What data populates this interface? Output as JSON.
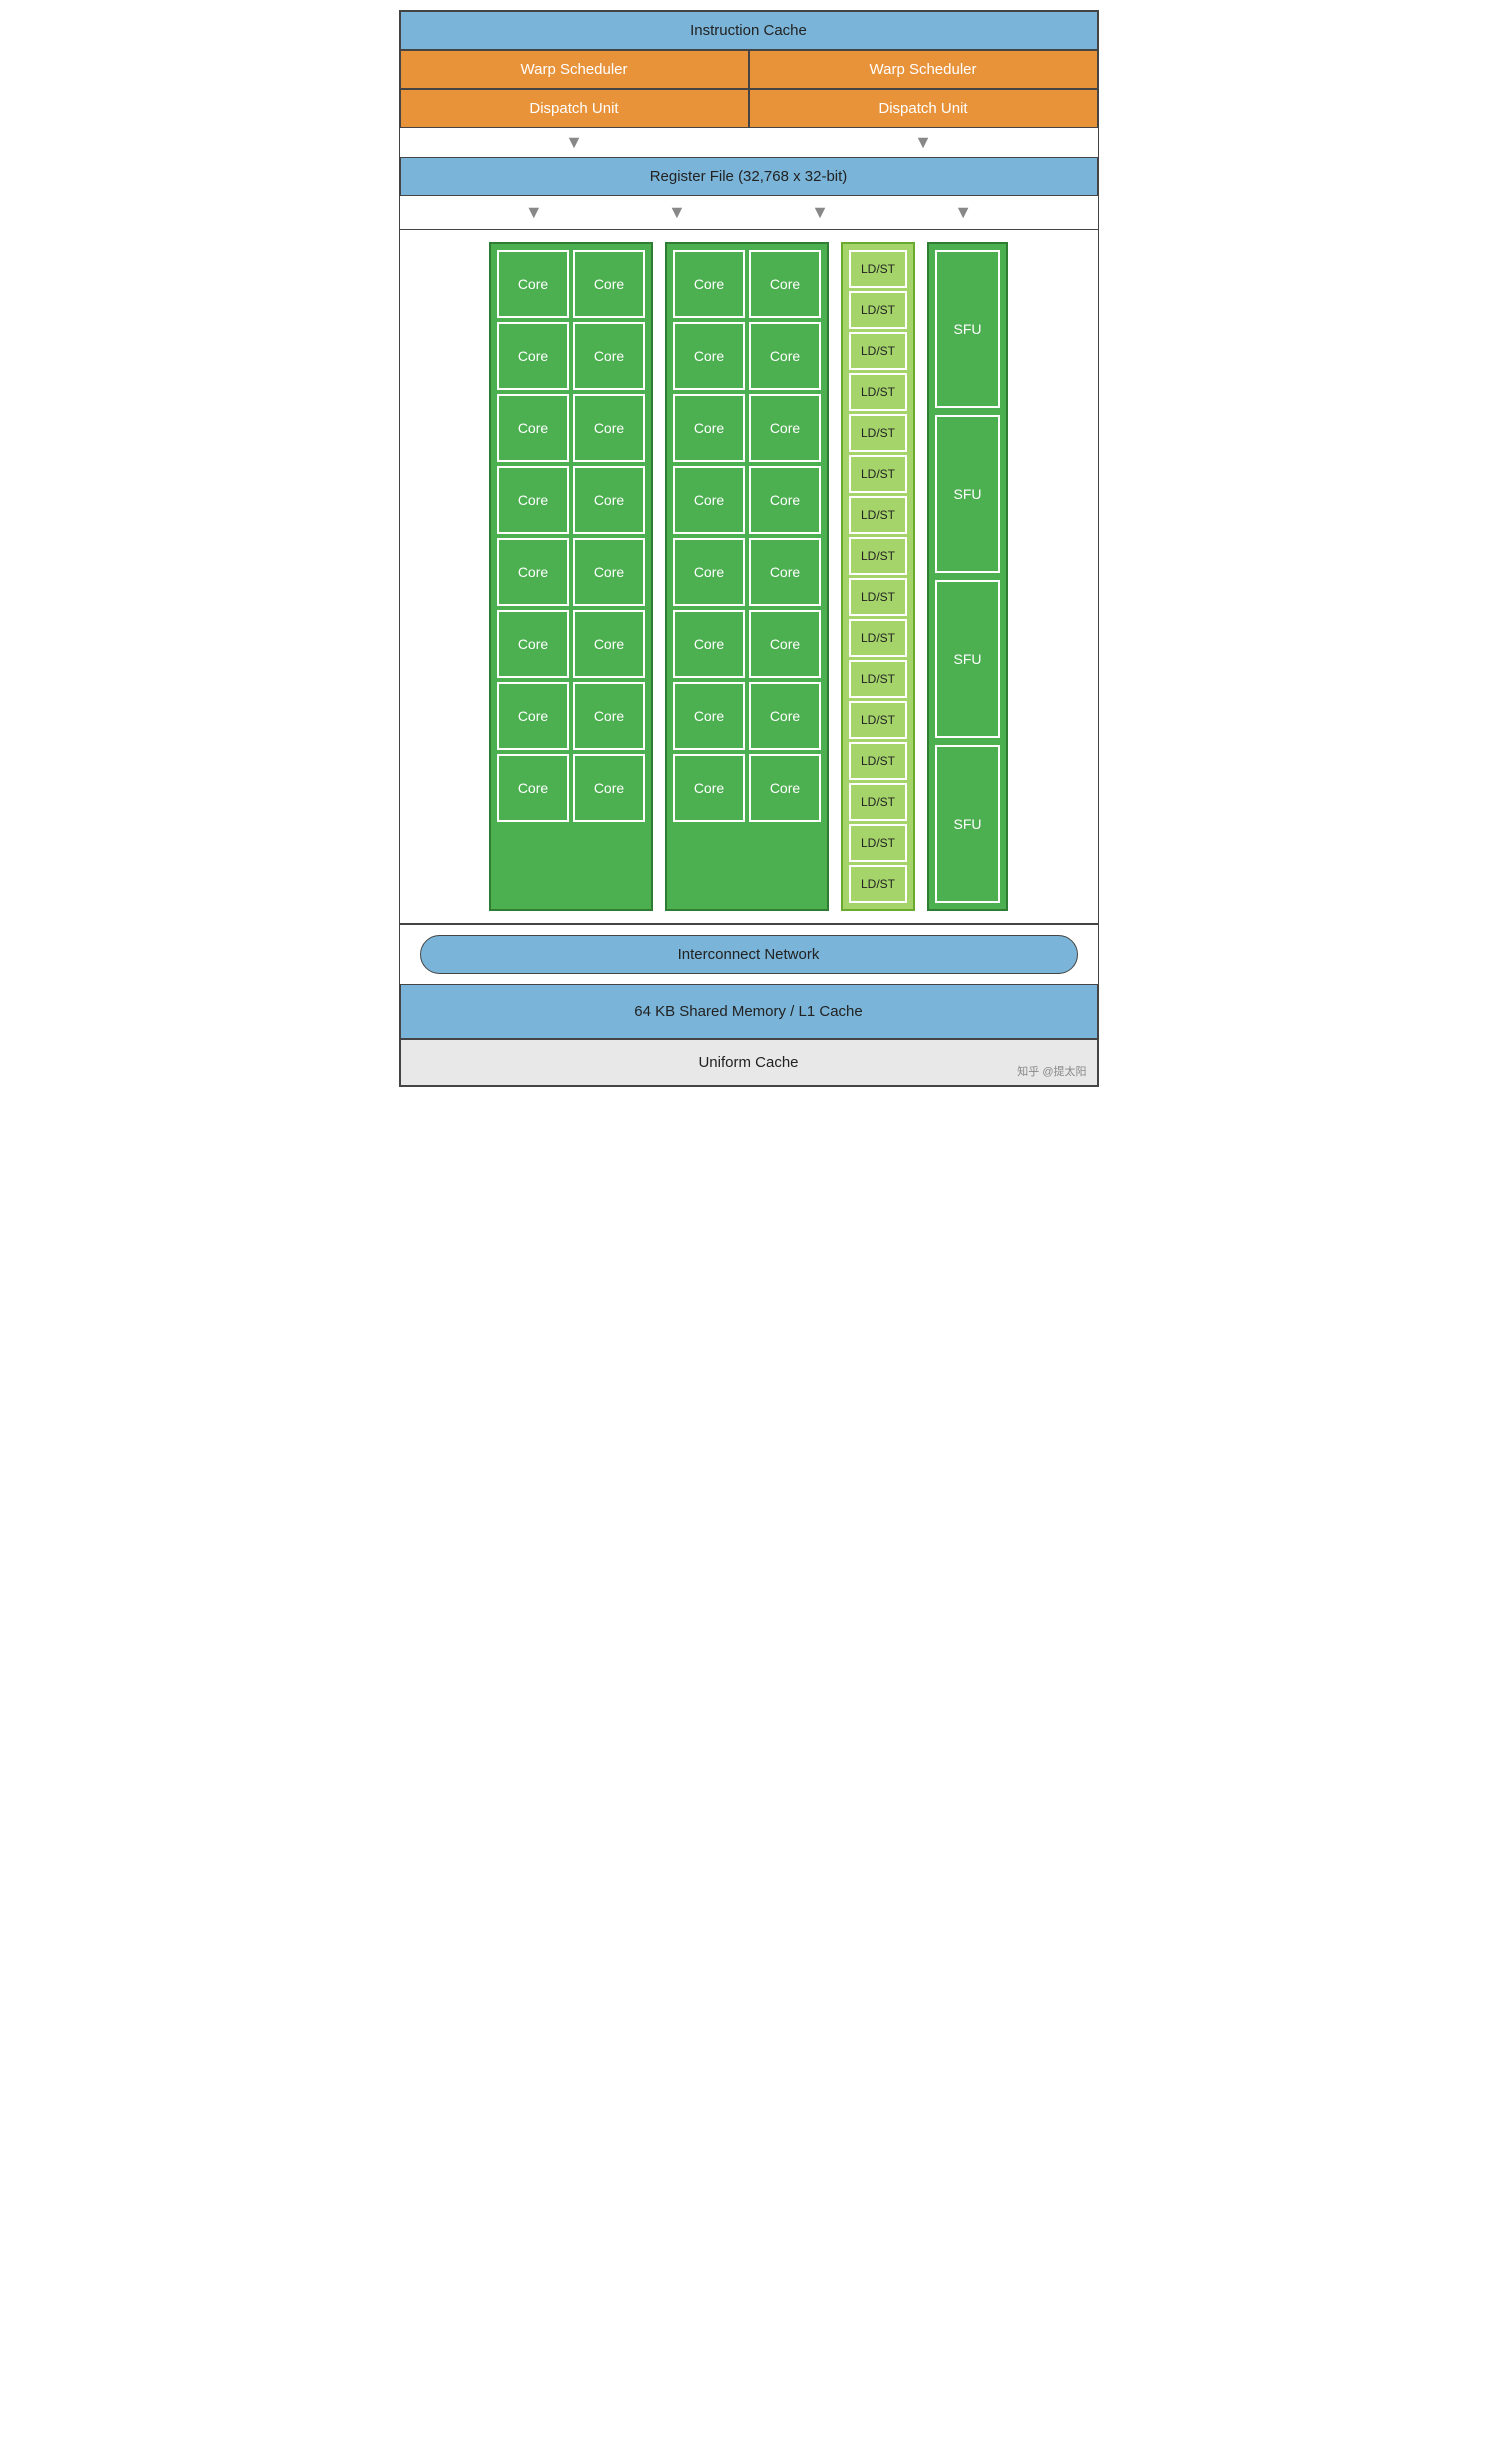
{
  "header": {
    "instruction_cache": "Instruction Cache",
    "warp_scheduler_left": "Warp Scheduler",
    "warp_scheduler_right": "Warp Scheduler",
    "dispatch_unit_left": "Dispatch Unit",
    "dispatch_unit_right": "Dispatch Unit",
    "register_file": "Register File (32,768 x 32-bit)"
  },
  "core_groups": [
    {
      "id": "group1",
      "rows": [
        [
          "Core",
          "Core"
        ],
        [
          "Core",
          "Core"
        ],
        [
          "Core",
          "Core"
        ],
        [
          "Core",
          "Core"
        ],
        [
          "Core",
          "Core"
        ],
        [
          "Core",
          "Core"
        ],
        [
          "Core",
          "Core"
        ],
        [
          "Core",
          "Core"
        ]
      ]
    },
    {
      "id": "group2",
      "rows": [
        [
          "Core",
          "Core"
        ],
        [
          "Core",
          "Core"
        ],
        [
          "Core",
          "Core"
        ],
        [
          "Core",
          "Core"
        ],
        [
          "Core",
          "Core"
        ],
        [
          "Core",
          "Core"
        ],
        [
          "Core",
          "Core"
        ],
        [
          "Core",
          "Core"
        ]
      ]
    }
  ],
  "ldst_units": [
    "LD/ST",
    "LD/ST",
    "LD/ST",
    "LD/ST",
    "LD/ST",
    "LD/ST",
    "LD/ST",
    "LD/ST",
    "LD/ST",
    "LD/ST",
    "LD/ST",
    "LD/ST",
    "LD/ST",
    "LD/ST",
    "LD/ST",
    "LD/ST"
  ],
  "sfu_units": [
    "SFU",
    "SFU",
    "SFU",
    "SFU"
  ],
  "interconnect": "Interconnect Network",
  "shared_memory": "64 KB Shared Memory / L1 Cache",
  "uniform_cache": "Uniform Cache",
  "watermark": "知乎 @提太阳"
}
